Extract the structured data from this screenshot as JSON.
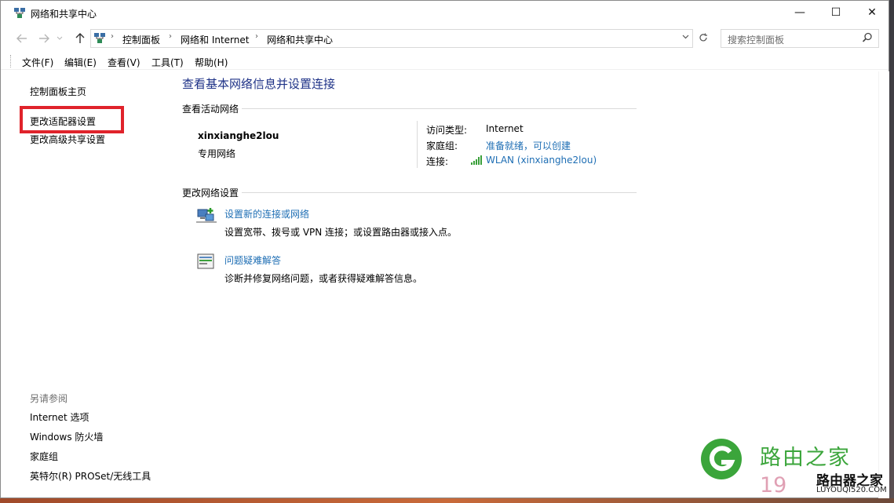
{
  "window": {
    "title": "网络和共享中心",
    "min_glyph": "—",
    "max_glyph": "☐",
    "close_glyph": "✕"
  },
  "address": {
    "breadcrumbs": [
      "控制面板",
      "网络和 Internet",
      "网络和共享中心"
    ],
    "search_placeholder": "搜索控制面板"
  },
  "menu": [
    "文件(F)",
    "编辑(E)",
    "查看(V)",
    "工具(T)",
    "帮助(H)"
  ],
  "sidebar": {
    "items": [
      "控制面板主页",
      "更改适配器设置",
      "更改高级共享设置"
    ],
    "see_also_title": "另请参阅",
    "see_also": [
      "Internet 选项",
      "Windows 防火墙",
      "家庭组",
      "英特尔(R) PROSet/无线工具"
    ]
  },
  "main": {
    "heading": "查看基本网络信息并设置连接",
    "active_section": "查看活动网络",
    "network": {
      "name": "xinxianghe2lou",
      "type": "专用网络",
      "access_label": "访问类型:",
      "access_value": "Internet",
      "homegroup_label": "家庭组:",
      "homegroup_value": "准备就绪，可以创建",
      "connection_label": "连接:",
      "connection_value": "WLAN (xinxianghe2lou)"
    },
    "change_section": "更改网络设置",
    "tasks": [
      {
        "link": "设置新的连接或网络",
        "desc": "设置宽带、拨号或 VPN 连接；或设置路由器或接入点。",
        "icon": "network-setup-icon"
      },
      {
        "link": "问题疑难解答",
        "desc": "诊断并修复网络问题，或者获得疑难解答信息。",
        "icon": "troubleshoot-icon"
      }
    ]
  },
  "watermark": {
    "name": "路由之家",
    "number": "19",
    "name2": "路由器之家",
    "url": "LUYOUQI520.COM"
  },
  "colors": {
    "link": "#1e6eb4",
    "heading": "#1e3287",
    "highlight": "#e0232b"
  }
}
